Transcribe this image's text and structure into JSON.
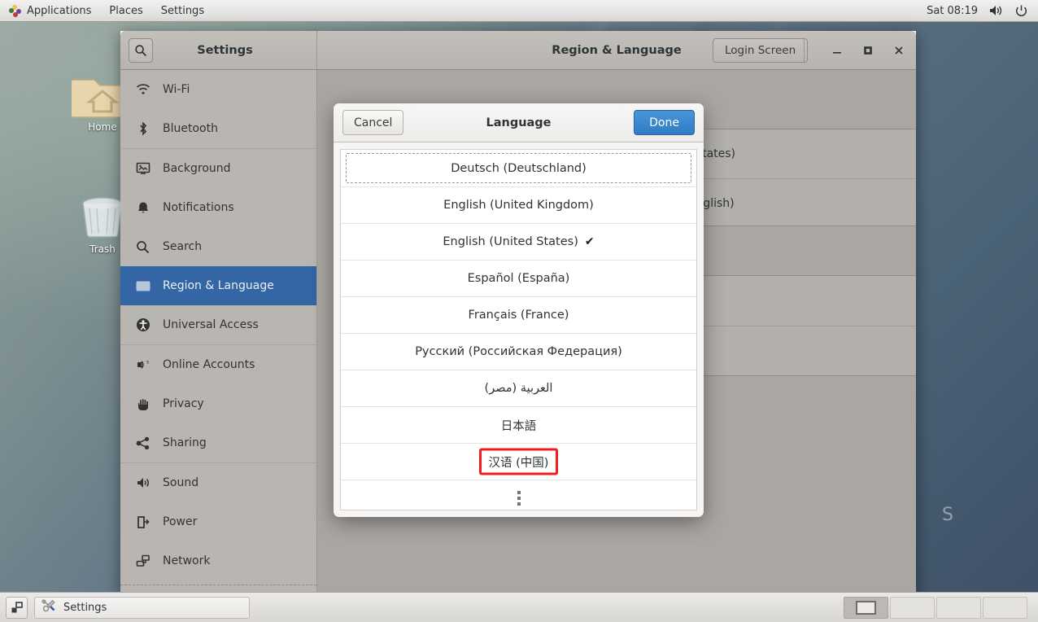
{
  "top_panel": {
    "menus": [
      "Applications",
      "Places",
      "Settings"
    ],
    "clock": "Sat 08:19",
    "volume_icon": "volume-icon",
    "power_icon": "power-icon",
    "logo_icon": "gnome-logo-icon"
  },
  "desktop": {
    "icons": [
      {
        "label": "Home",
        "icon": "home-folder-icon"
      },
      {
        "label": "Trash",
        "icon": "trash-icon"
      }
    ],
    "wallpaper_text": "S"
  },
  "window": {
    "app_title": "Settings",
    "page_title": "Region & Language",
    "search_icon": "search-icon",
    "login_screen_label": "Login Screen",
    "controls": {
      "minimize": "–",
      "maximize": "□",
      "close": "✕"
    }
  },
  "sidebar": {
    "items": [
      {
        "label": "Wi-Fi",
        "icon": "wifi-icon",
        "selected": false
      },
      {
        "label": "Bluetooth",
        "icon": "bluetooth-icon",
        "selected": false
      },
      {
        "label": "Background",
        "icon": "background-icon",
        "selected": false
      },
      {
        "label": "Notifications",
        "icon": "bell-icon",
        "selected": false
      },
      {
        "label": "Search",
        "icon": "search-icon",
        "selected": false
      },
      {
        "label": "Region & Language",
        "icon": "region-language-icon",
        "selected": true
      },
      {
        "label": "Universal Access",
        "icon": "accessibility-icon",
        "selected": false
      },
      {
        "label": "Online Accounts",
        "icon": "online-accounts-icon",
        "selected": false
      },
      {
        "label": "Privacy",
        "icon": "hand-icon",
        "selected": false
      },
      {
        "label": "Sharing",
        "icon": "share-icon",
        "selected": false
      },
      {
        "label": "Sound",
        "icon": "sound-icon",
        "selected": false
      },
      {
        "label": "Power",
        "icon": "power-plug-icon",
        "selected": false
      },
      {
        "label": "Network",
        "icon": "network-icon",
        "selected": false
      }
    ]
  },
  "background_panel": {
    "rows": [
      "glish (United States)",
      "ited States (English)"
    ],
    "keyboard_icon": "keyboard-icon"
  },
  "dialog": {
    "title": "Language",
    "cancel_label": "Cancel",
    "done_label": "Done",
    "done_color": "#2f7dc4",
    "highlight_color": "#f01d1d",
    "more_indicator": "vertical-ellipsis-icon",
    "languages": [
      {
        "label": "Deutsch (Deutschland)",
        "selected": false,
        "focused": true,
        "highlighted": false
      },
      {
        "label": "English (United Kingdom)",
        "selected": false,
        "focused": false,
        "highlighted": false
      },
      {
        "label": "English (United States)",
        "selected": true,
        "focused": false,
        "highlighted": false
      },
      {
        "label": "Español (España)",
        "selected": false,
        "focused": false,
        "highlighted": false
      },
      {
        "label": "Français (France)",
        "selected": false,
        "focused": false,
        "highlighted": false
      },
      {
        "label": "Русский (Российская Федерация)",
        "selected": false,
        "focused": false,
        "highlighted": false
      },
      {
        "label": "العربية (مصر)",
        "selected": false,
        "focused": false,
        "highlighted": false
      },
      {
        "label": "日本語",
        "selected": false,
        "focused": false,
        "highlighted": false
      },
      {
        "label": "汉语 (中国)",
        "selected": false,
        "focused": false,
        "highlighted": true
      }
    ],
    "check_mark": "✔"
  },
  "taskbar": {
    "show_desktop_icon": "show-desktop-icon",
    "task_label": "Settings",
    "task_icon": "settings-tools-icon",
    "workspace_count": 4,
    "active_workspace": 1
  }
}
